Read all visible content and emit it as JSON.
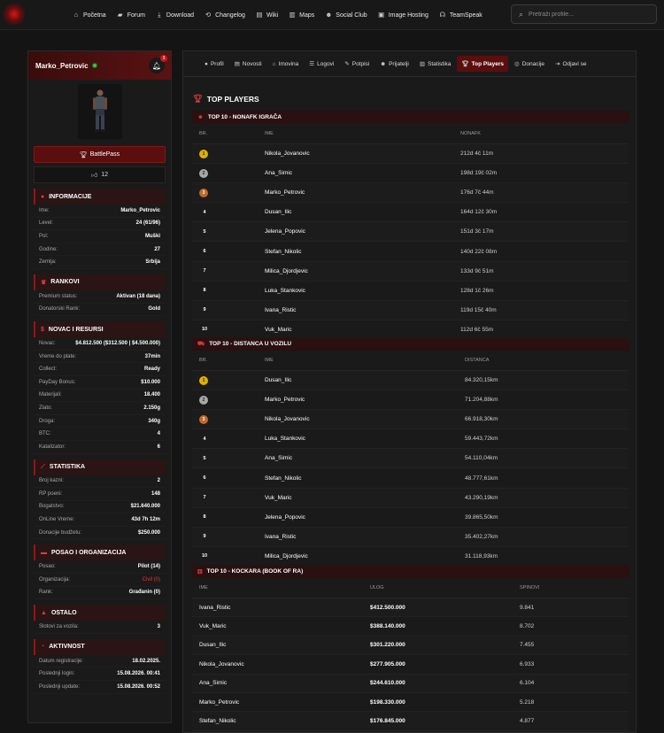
{
  "nav": {
    "items": [
      {
        "label": "Početna",
        "icon": "home-icon"
      },
      {
        "label": "Forum",
        "icon": "comments-icon"
      },
      {
        "label": "Download",
        "icon": "download-icon"
      },
      {
        "label": "Changelog",
        "icon": "changelog-icon"
      },
      {
        "label": "Wiki",
        "icon": "book-icon"
      },
      {
        "label": "Maps",
        "icon": "map-icon"
      },
      {
        "label": "Social Club",
        "icon": "users-icon"
      },
      {
        "label": "Image Hosting",
        "icon": "image-icon"
      },
      {
        "label": "TeamSpeak",
        "icon": "headset-icon"
      }
    ],
    "search_placeholder": "Pretraži profile..."
  },
  "profile": {
    "name": "Marko_Petrovic",
    "notifications": "3",
    "battlepass_label": "BattlePass",
    "likes": "12"
  },
  "sections": {
    "info": {
      "title": "INFORMACIJE",
      "rows": [
        {
          "k": "Ime:",
          "v": "Marko_Petrovic"
        },
        {
          "k": "Level:",
          "v": "24 (61/96)"
        },
        {
          "k": "Pol:",
          "v": "Muški"
        },
        {
          "k": "Godine:",
          "v": "27"
        },
        {
          "k": "Zemlja:",
          "v": "Srbija"
        }
      ]
    },
    "ranks": {
      "title": "RANKOVI",
      "rows": [
        {
          "k": "Premium status:",
          "v": "Aktivan (18 dana)"
        },
        {
          "k": "Donatorski Rank:",
          "v": "Gold"
        }
      ]
    },
    "money": {
      "title": "NOVAC I RESURSI",
      "rows": [
        {
          "k": "Novac:",
          "v": "$4.812.500 ($312.500 | $4.500.000)"
        },
        {
          "k": "Vreme do plate:",
          "v": "37min"
        },
        {
          "k": "Collect:",
          "v": "Ready"
        },
        {
          "k": "PayDay Bonus:",
          "v": "$10.000"
        },
        {
          "k": "Materijali:",
          "v": "18.400"
        },
        {
          "k": "Zlato:",
          "v": "2.150g"
        },
        {
          "k": "Droga:",
          "v": "340g"
        },
        {
          "k": "BTC:",
          "v": "4"
        },
        {
          "k": "Katalizator:",
          "v": "6"
        }
      ]
    },
    "stats": {
      "title": "STATISTIKA",
      "rows": [
        {
          "k": "Broj kazni:",
          "v": "2"
        },
        {
          "k": "RP poeni:",
          "v": "148"
        },
        {
          "k": "Bogatstvo:",
          "v": "$21.640.000"
        },
        {
          "k": "OnLine Vreme:",
          "v": "43d 7h 12m"
        },
        {
          "k": "Donacije budžetu:",
          "v": "$250.000"
        }
      ]
    },
    "job": {
      "title": "POSAO I ORGANIZACIJA",
      "rows": [
        {
          "k": "Posao:",
          "v": "Pilot (14)"
        },
        {
          "k": "Organizacija:",
          "v": "Civil (0)"
        },
        {
          "k": "Rank:",
          "v": "Građanin (0)"
        }
      ]
    },
    "other": {
      "title": "OSTALO",
      "rows": [
        {
          "k": "Slotovi za vozila:",
          "v": "3"
        }
      ]
    },
    "activity": {
      "title": "AKTIVNOST",
      "rows": [
        {
          "k": "Datum registracije:",
          "v": "18.02.2025."
        },
        {
          "k": "Poslednji login:",
          "v": "15.08.2026. 00:41"
        },
        {
          "k": "Poslednji update:",
          "v": "15.08.2026. 00:52"
        }
      ]
    }
  },
  "tabs": [
    {
      "label": "Profil",
      "icon": "user-icon"
    },
    {
      "label": "Novosti",
      "icon": "news-icon"
    },
    {
      "label": "Imovina",
      "icon": "home-icon"
    },
    {
      "label": "Logovi",
      "icon": "list-icon"
    },
    {
      "label": "Potpisi",
      "icon": "signature-icon"
    },
    {
      "label": "Prijatelji",
      "icon": "friends-icon"
    },
    {
      "label": "Statistika",
      "icon": "chart-icon"
    },
    {
      "label": "Top Players",
      "icon": "trophy-icon",
      "active": true
    },
    {
      "label": "Donacije",
      "icon": "donation-icon"
    },
    {
      "label": "Odjavi se",
      "icon": "logout-icon"
    }
  ],
  "main": {
    "title": "TOP PLAYERS",
    "nonafk": {
      "title": "TOP 10 - NONAFK IGRAČA",
      "cols": [
        "BR.",
        "IME",
        "NONAFK"
      ],
      "rows": [
        {
          "br": "1",
          "ime": "Nikola_Jovanovic",
          "val": "212d 4č 11m"
        },
        {
          "br": "2",
          "ime": "Ana_Simic",
          "val": "198d 19č 02m"
        },
        {
          "br": "3",
          "ime": "Marko_Petrovic",
          "val": "176d 7č 44m"
        },
        {
          "br": "4",
          "ime": "Dusan_Ilic",
          "val": "164d 12č 30m"
        },
        {
          "br": "5",
          "ime": "Jelena_Popovic",
          "val": "151d 3č 17m"
        },
        {
          "br": "6",
          "ime": "Stefan_Nikolic",
          "val": "140d 22č 08m"
        },
        {
          "br": "7",
          "ime": "Milica_Djordjevic",
          "val": "133d 9č 51m"
        },
        {
          "br": "8",
          "ime": "Luka_Stankovic",
          "val": "128d 1č 26m"
        },
        {
          "br": "9",
          "ime": "Ivana_Ristic",
          "val": "119d 15č 40m"
        },
        {
          "br": "10",
          "ime": "Vuk_Maric",
          "val": "112d 6č 55m"
        }
      ]
    },
    "distance": {
      "title": "TOP 10 - DISTANCA U VOZILU",
      "cols": [
        "BR.",
        "IME",
        "DISTANCA"
      ],
      "rows": [
        {
          "br": "1",
          "ime": "Dusan_Ilic",
          "val": "84.320,15km"
        },
        {
          "br": "2",
          "ime": "Marko_Petrovic",
          "val": "71.204,88km"
        },
        {
          "br": "3",
          "ime": "Nikola_Jovanovic",
          "val": "66.918,30km"
        },
        {
          "br": "4",
          "ime": "Luka_Stankovic",
          "val": "59.443,72km"
        },
        {
          "br": "5",
          "ime": "Ana_Simic",
          "val": "54.110,04km"
        },
        {
          "br": "6",
          "ime": "Stefan_Nikolic",
          "val": "48.777,61km"
        },
        {
          "br": "7",
          "ime": "Vuk_Maric",
          "val": "43.290,19km"
        },
        {
          "br": "8",
          "ime": "Jelena_Popovic",
          "val": "39.865,50km"
        },
        {
          "br": "9",
          "ime": "Ivana_Ristic",
          "val": "35.402,27km"
        },
        {
          "br": "10",
          "ime": "Milica_Djordjevic",
          "val": "31.118,93km"
        }
      ]
    },
    "casino": {
      "title": "TOP 10 - KOCKARA (BOOK OF RA)",
      "cols": [
        "IME",
        "ULOG",
        "SPINOVI"
      ],
      "rows": [
        {
          "ime": "Ivana_Ristic",
          "ulog": "$412.500.000",
          "spin": "9.841"
        },
        {
          "ime": "Vuk_Maric",
          "ulog": "$388.140.000",
          "spin": "8.702"
        },
        {
          "ime": "Dusan_Ilic",
          "ulog": "$301.220.000",
          "spin": "7.455"
        },
        {
          "ime": "Nikola_Jovanovic",
          "ulog": "$277.905.000",
          "spin": "6.933"
        },
        {
          "ime": "Ana_Simic",
          "ulog": "$244.610.000",
          "spin": "6.104"
        },
        {
          "ime": "Marko_Petrovic",
          "ulog": "$198.330.000",
          "spin": "5.218"
        },
        {
          "ime": "Stefan_Nikolic",
          "ulog": "$176.845.000",
          "spin": "4.877"
        }
      ]
    }
  }
}
